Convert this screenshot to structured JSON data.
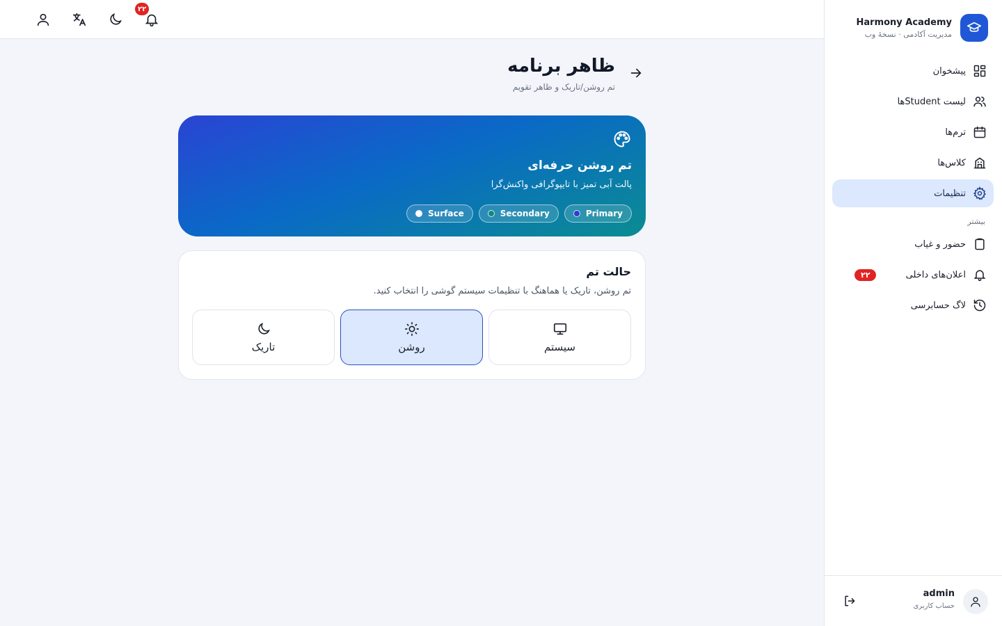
{
  "brand": {
    "title": "Harmony Academy",
    "subtitle": "مدیریت آکادمی · نسخهٔ وب",
    "icon": "graduation-cap-icon"
  },
  "sidebar": {
    "items": [
      {
        "label": "پیشخوان",
        "icon": "dashboard-icon",
        "active": false
      },
      {
        "label": "لیست Studentها",
        "icon": "users-icon",
        "active": false
      },
      {
        "label": "ترم‌ها",
        "icon": "calendar-icon",
        "active": false
      },
      {
        "label": "کلاس‌ها",
        "icon": "building-icon",
        "active": false
      },
      {
        "label": "تنظیمات",
        "icon": "gear-icon",
        "active": true
      }
    ],
    "section_label": "بیشتر",
    "more_items": [
      {
        "label": "حضور و غیاب",
        "icon": "clipboard-icon"
      },
      {
        "label": "اعلان‌های داخلی",
        "icon": "bell-icon",
        "badge": "۲۲"
      },
      {
        "label": "لاگ حسابرسی",
        "icon": "history-icon"
      }
    ]
  },
  "user": {
    "name": "admin",
    "role": "حساب کاربری"
  },
  "topbar": {
    "notification_count": "۲۲"
  },
  "page": {
    "title": "ظاهر برنامه",
    "subtitle": "تم روشن/تاریک و ظاهر تقویم"
  },
  "theme_card": {
    "title": "تم روشن حرفه‌ای",
    "subtitle": "پالت آبی تمیز با تایپوگرافی واکنش‌گرا",
    "chips": [
      {
        "label": "Primary",
        "color": "#2a3fd0"
      },
      {
        "label": "Secondary",
        "color": "#0c8a7c"
      },
      {
        "label": "Surface",
        "color": "#ffffff"
      }
    ]
  },
  "mode_card": {
    "title": "حالت تم",
    "subtitle": "تم روشن، تاریک یا هماهنگ با تنظیمات سیستم گوشی را انتخاب کنید.",
    "options": [
      {
        "label": "سیستم",
        "icon": "monitor-icon",
        "selected": false
      },
      {
        "label": "روشن",
        "icon": "sun-icon",
        "selected": true
      },
      {
        "label": "تاریک",
        "icon": "moon-icon",
        "selected": false
      }
    ]
  },
  "colors": {
    "accent": "#1f57d6",
    "active_bg": "#dbe8fd",
    "badge": "#e02424"
  }
}
